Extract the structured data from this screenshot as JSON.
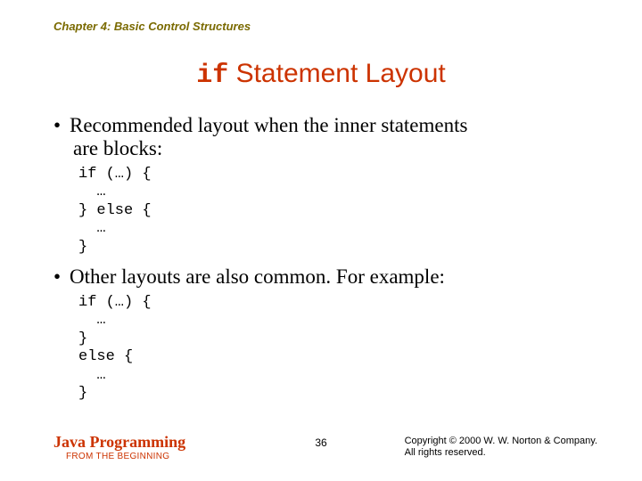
{
  "header": {
    "chapter": "Chapter 4: Basic Control Structures"
  },
  "title": {
    "code": "if",
    "rest": " Statement Layout"
  },
  "bullets": {
    "first_l1": "Recommended layout when the inner statements",
    "first_l2": "are blocks:",
    "second": "Other layouts are also common. For example:"
  },
  "code": {
    "block1": "if (…) {\n  …\n} else {\n  …\n}",
    "block2": "if (…) {\n  …\n}\nelse {\n  …\n}"
  },
  "footer": {
    "brand": "Java Programming",
    "subbrand": "FROM THE BEGINNING",
    "page": "36",
    "copyright_l1": "Copyright © 2000 W. W. Norton & Company.",
    "copyright_l2": "All rights reserved."
  }
}
